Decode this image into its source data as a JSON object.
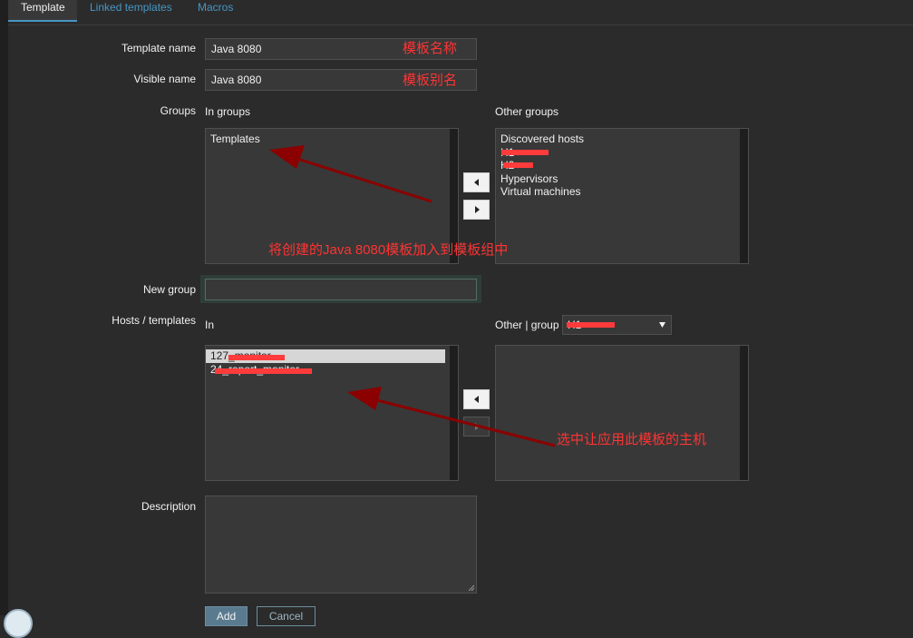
{
  "tabs": [
    {
      "label": "Template",
      "active": true
    },
    {
      "label": "Linked templates",
      "active": false
    },
    {
      "label": "Macros",
      "active": false
    }
  ],
  "form": {
    "template_name_label": "Template name",
    "template_name_value": "Java 8080",
    "visible_name_label": "Visible name",
    "visible_name_value": "Java 8080",
    "groups_label": "Groups",
    "in_groups_label": "In groups",
    "other_groups_label": "Other groups",
    "in_groups": [
      "Templates"
    ],
    "other_groups": [
      "Discovered hosts",
      "H1",
      "H2",
      "Hypervisors",
      "Virtual machines"
    ],
    "new_group_label": "New group",
    "new_group_value": "",
    "hosts_label": "Hosts / templates",
    "in_label": "In",
    "other_group_label": "Other | group",
    "other_group_selected": "H1",
    "in_hosts": [
      "127_monitor",
      "24_report_monitor"
    ],
    "description_label": "Description",
    "description_value": "",
    "add_button": "Add",
    "cancel_button": "Cancel"
  },
  "annotations": {
    "template_name_note": "模板名称",
    "visible_name_note": "模板别名",
    "groups_note": "将创建的Java 8080模板加入到模板组中",
    "hosts_note": "选中让应用此模板的主机"
  },
  "colors": {
    "background": "#2b2b2b",
    "field": "#383838",
    "accent": "#4796c4",
    "annotation": "#ff3333",
    "arrow": "#8b0000",
    "redaction": "#ff3b3b"
  },
  "icons": [
    "arrow-left-icon",
    "arrow-right-icon",
    "chevron-down-icon"
  ]
}
